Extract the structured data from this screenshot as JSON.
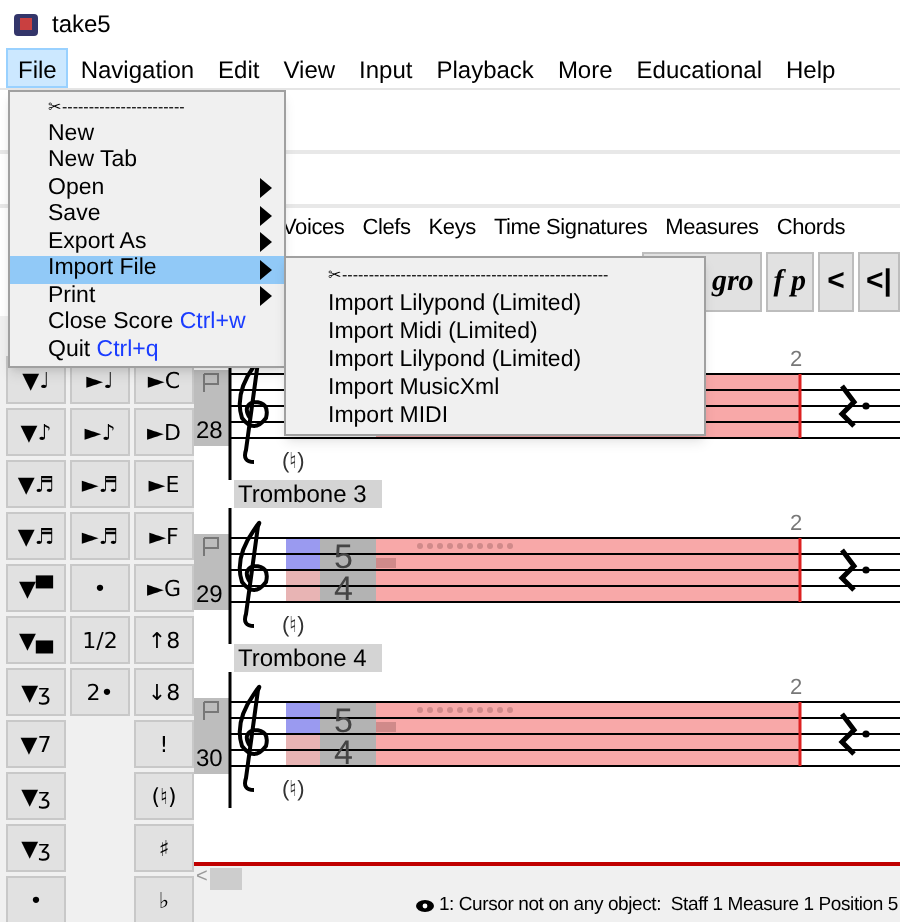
{
  "window": {
    "title": "take5"
  },
  "menu_bar": [
    {
      "label": "File",
      "selected": true
    },
    {
      "label": "Navigation",
      "selected": false
    },
    {
      "label": "Edit",
      "selected": false
    },
    {
      "label": "View",
      "selected": false
    },
    {
      "label": "Input",
      "selected": false
    },
    {
      "label": "Playback",
      "selected": false
    },
    {
      "label": "More",
      "selected": false
    },
    {
      "label": "Educational",
      "selected": false
    },
    {
      "label": "Help",
      "selected": false
    }
  ],
  "file_menu": [
    {
      "kind": "tearoff",
      "label": "✂-----------------------",
      "selected": false
    },
    {
      "kind": "item",
      "label": "New",
      "selected": false
    },
    {
      "kind": "item",
      "label": "New Tab",
      "selected": false
    },
    {
      "kind": "submenu",
      "label": "Open",
      "selected": false
    },
    {
      "kind": "submenu",
      "label": "Save",
      "selected": false
    },
    {
      "kind": "submenu",
      "label": "Export As",
      "selected": false
    },
    {
      "kind": "submenu",
      "label": "Import File",
      "selected": true
    },
    {
      "kind": "submenu",
      "label": "Print",
      "selected": false
    },
    {
      "kind": "item",
      "label": "Close Score",
      "shortcut": "Ctrl+w",
      "selected": false
    },
    {
      "kind": "item",
      "label": "Quit",
      "shortcut": "Ctrl+q",
      "selected": false
    }
  ],
  "import_submenu": [
    {
      "kind": "tearoff",
      "label": "✂--------------------------------------------------"
    },
    {
      "kind": "item",
      "label": "Import Lilypond (Limited)"
    },
    {
      "kind": "item",
      "label": "Import Midi (Limited)"
    },
    {
      "kind": "item",
      "label": "Import Lilypond (Limited)"
    },
    {
      "kind": "item",
      "label": "Import MusicXml"
    },
    {
      "kind": "item",
      "label": "Import MIDI"
    }
  ],
  "tabs": [
    "Voices",
    "Clefs",
    "Keys",
    "Time Signatures",
    "Measures",
    "Chords"
  ],
  "dynamics_buttons": [
    {
      "kind": "dynamic",
      "label": "gro"
    },
    {
      "kind": "dynamic",
      "label": "f p"
    },
    {
      "kind": "plain",
      "label": "<"
    },
    {
      "kind": "plain",
      "label": "<|"
    }
  ],
  "palette_columns": [
    [
      "▼♩",
      "▼♪",
      "▼♬",
      "▼♬",
      "▼▀",
      "▼▄",
      "▼ʒ",
      "▼7",
      "▼ʒ",
      "▼ʒ",
      "•"
    ],
    [
      "►♩",
      "►♪",
      "►♬",
      "►♬",
      "•",
      "1/2",
      "2•"
    ],
    [
      "►C",
      "►D",
      "►E",
      "►F",
      "►G",
      "↑8",
      "↓8",
      "!",
      "(♮)",
      "♯",
      "♭"
    ]
  ],
  "scroll_left": "<",
  "staves": [
    {
      "number": "28",
      "measure_number": "2",
      "accidental": "(♮)"
    },
    {
      "label": "Trombone 3",
      "number": "29",
      "measure_number": "2",
      "time_signature": [
        "5",
        "4"
      ],
      "accidental": "(♮)"
    },
    {
      "label": "Trombone 4",
      "number": "30",
      "measure_number": "2",
      "time_signature": [
        "5",
        "4"
      ],
      "accidental": "(♮)"
    }
  ],
  "status_bar": "1: Cursor not on any object:  Staff 1 Measure 1 Position 5"
}
